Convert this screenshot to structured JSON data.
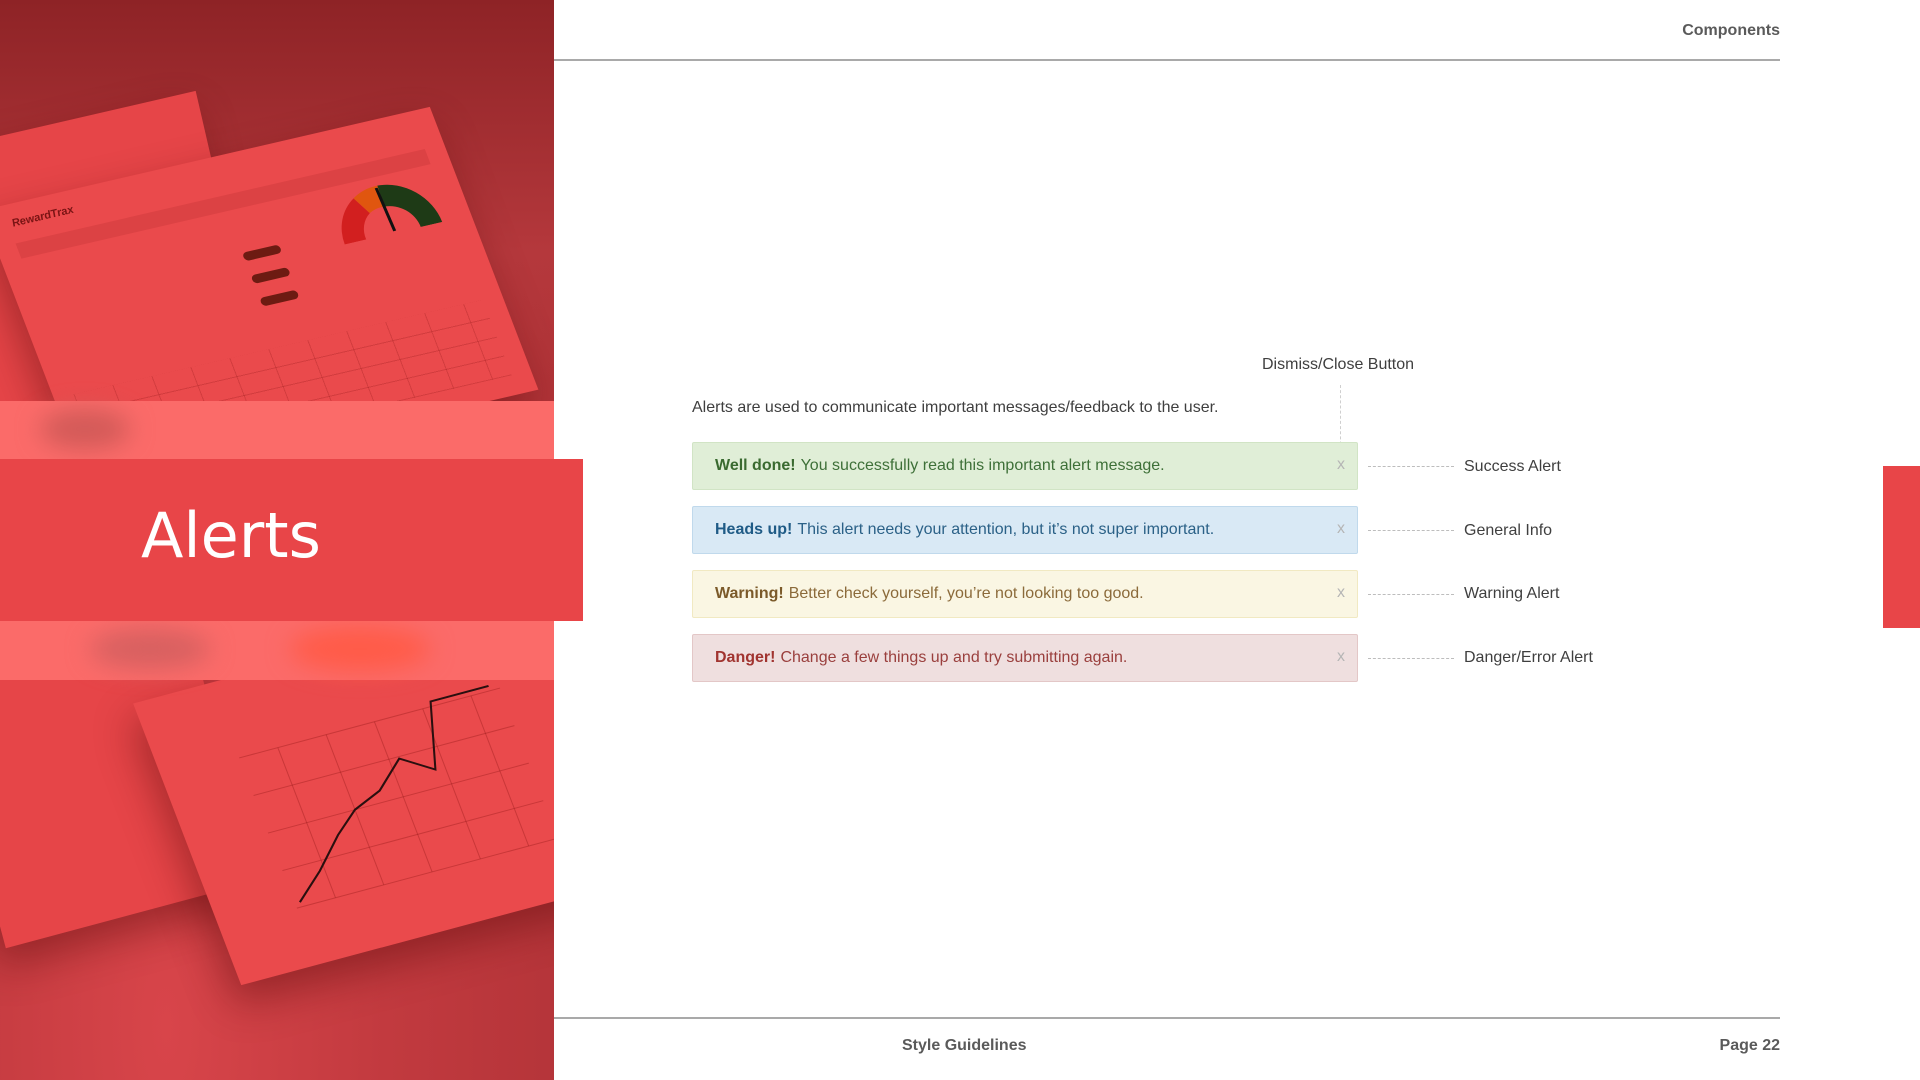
{
  "header": {
    "section": "Components"
  },
  "hero": {
    "title": "Alerts",
    "mock_logo": "RewardTrax"
  },
  "content": {
    "intro": "Alerts are used to communicate important messages/feedback to the user.",
    "dismiss_label": "Dismiss/Close Button",
    "alerts": [
      {
        "strong": "Well done!",
        "text": "You successfully read this important alert message.",
        "close": "x",
        "label": "Success Alert"
      },
      {
        "strong": "Heads up!",
        "text": "This alert needs your attention, but it’s not super important.",
        "close": "x",
        "label": "General Info"
      },
      {
        "strong": "Warning!",
        "text": "Better check yourself, you’re not looking too good.",
        "close": "x",
        "label": "Warning Alert"
      },
      {
        "strong": "Danger!",
        "text": "Change a few things up and try submitting again.",
        "close": "x",
        "label": "Danger/Error Alert"
      }
    ]
  },
  "footer": {
    "center": "Style Guidelines",
    "page": "Page 22"
  },
  "colors": {
    "brand_red": "#e84548",
    "success_bg": "#e0eed7",
    "info_bg": "#d9e9f5",
    "warning_bg": "#faf6e3",
    "danger_bg": "#efdfdf"
  }
}
